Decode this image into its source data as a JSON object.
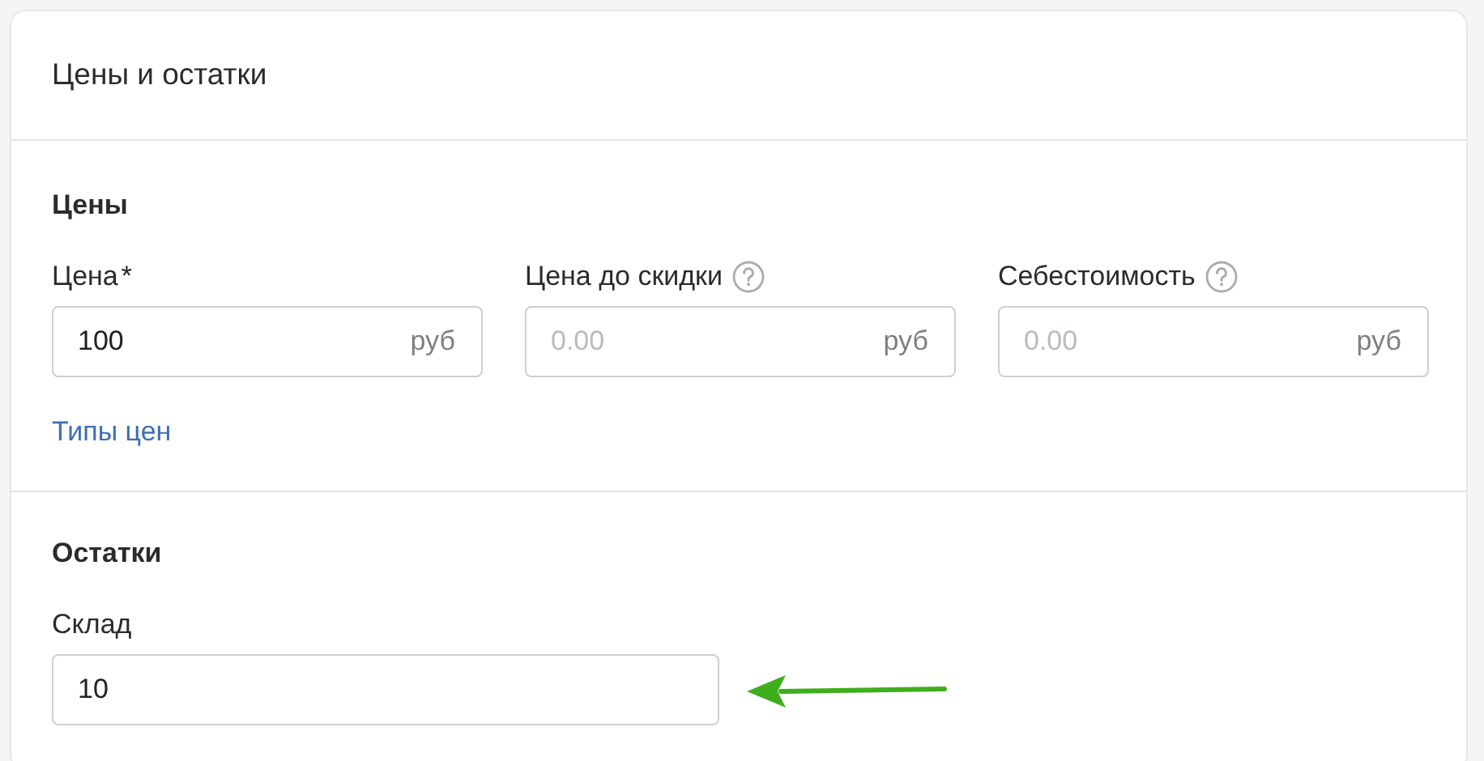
{
  "card": {
    "title": "Цены и остатки"
  },
  "sections": [
    {
      "title": "Цены",
      "fields": [
        {
          "label": "Цена",
          "required_mark": "*",
          "help": false,
          "value": "100",
          "unit": "руб"
        },
        {
          "label": "Цена до скидки",
          "help": true,
          "placeholder": "0.00",
          "unit": "руб"
        },
        {
          "label": "Себестоимость",
          "help": true,
          "placeholder": "0.00",
          "unit": "руб"
        }
      ],
      "link": "Типы цен"
    },
    {
      "title": "Остатки",
      "fields": [
        {
          "label": "Склад",
          "help": false,
          "value": "10",
          "wide": true,
          "pointer": true
        }
      ]
    }
  ]
}
